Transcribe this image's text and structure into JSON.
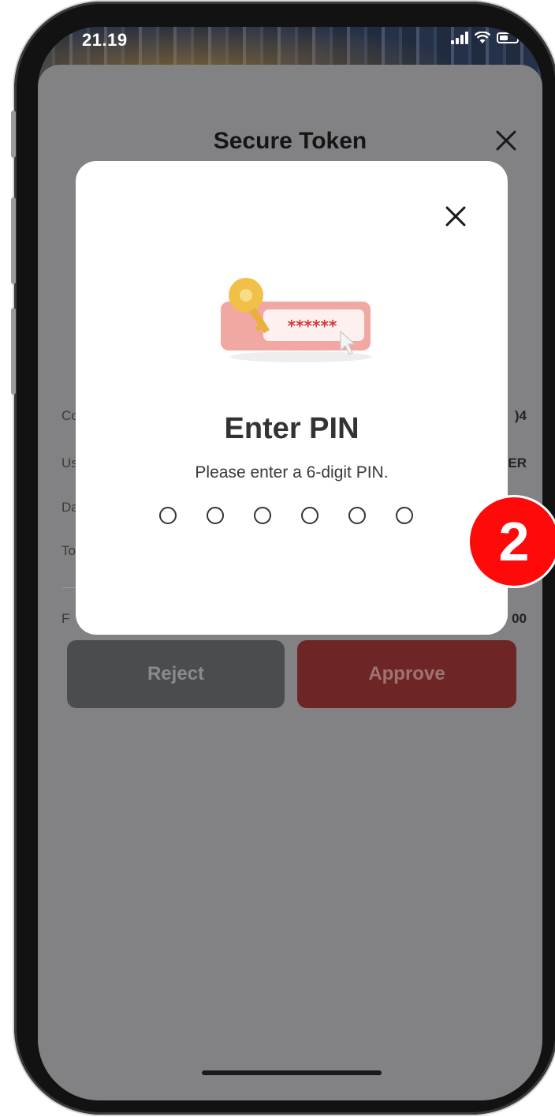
{
  "status_bar": {
    "time": "21.19"
  },
  "sheet": {
    "title": "Secure Token",
    "rows": [
      {
        "label": "Co",
        "value": ")4"
      },
      {
        "label": "Us",
        "value": "ER"
      },
      {
        "label": "Da",
        "value": ""
      },
      {
        "label": "To",
        "value": ""
      },
      {
        "label": "F",
        "value": "00"
      }
    ],
    "reject_label": "Reject",
    "approve_label": "Approve"
  },
  "modal": {
    "title": "Enter PIN",
    "subtitle": "Please enter a 6-digit PIN.",
    "masked_text": "******",
    "pin_length": 6
  },
  "step_badge": "2",
  "colors": {
    "badge": "#ff0a0a",
    "approve": "#6e2525",
    "reject": "#4a4c50",
    "overlay": "#828285"
  }
}
